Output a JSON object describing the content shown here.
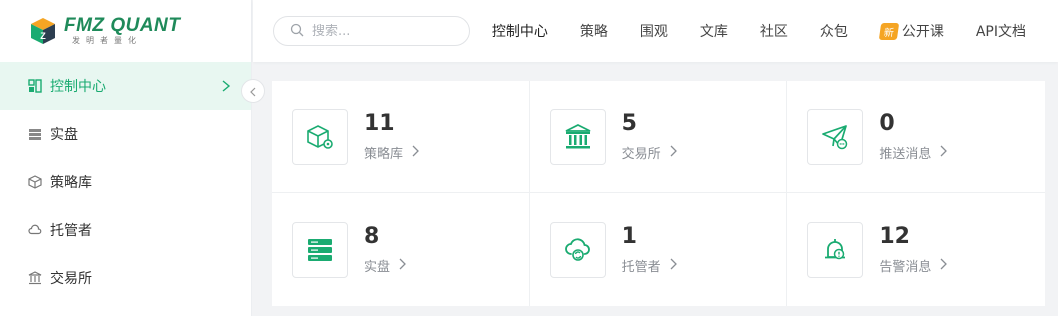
{
  "brand": {
    "name": "FMZ QUANT",
    "tagline": "发明者量化",
    "color": "#1aab71"
  },
  "sidebar": {
    "items": [
      {
        "label": "控制中心",
        "icon": "dashboard-icon",
        "active": true
      },
      {
        "label": "实盘",
        "icon": "server-icon",
        "active": false
      },
      {
        "label": "策略库",
        "icon": "cube-icon",
        "active": false
      },
      {
        "label": "托管者",
        "icon": "cloud-icon",
        "active": false
      },
      {
        "label": "交易所",
        "icon": "bank-icon",
        "active": false
      }
    ]
  },
  "search": {
    "placeholder": "搜索..."
  },
  "top_nav": [
    {
      "label": "控制中心"
    },
    {
      "label": "策略"
    },
    {
      "label": "围观"
    },
    {
      "label": "文库"
    },
    {
      "label": "社区"
    },
    {
      "label": "众包"
    },
    {
      "label": "公开课",
      "badge": "新"
    },
    {
      "label": "API文档"
    }
  ],
  "stats": [
    {
      "count": "11",
      "label": "策略库",
      "icon": "cube-gear-icon"
    },
    {
      "count": "5",
      "label": "交易所",
      "icon": "bank-icon"
    },
    {
      "count": "0",
      "label": "推送消息",
      "icon": "paper-plane-icon"
    },
    {
      "count": "8",
      "label": "实盘",
      "icon": "server-icon"
    },
    {
      "count": "1",
      "label": "托管者",
      "icon": "cloud-sync-icon"
    },
    {
      "count": "12",
      "label": "告警消息",
      "icon": "alarm-bell-icon"
    }
  ]
}
